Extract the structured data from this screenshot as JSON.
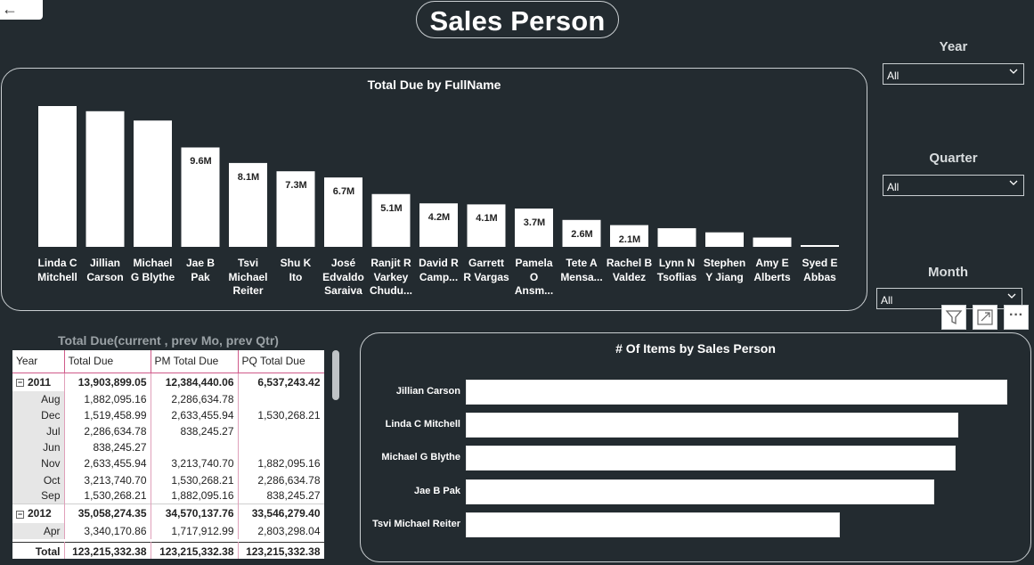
{
  "nav": {
    "back_icon": "←"
  },
  "page": {
    "title": "Sales Person"
  },
  "bar_chart": {
    "title": "Total Due by FullName",
    "bars": [
      {
        "label": "Linda C Mitchell",
        "lines": [
          "Linda C",
          "Mitchell"
        ],
        "value": 13.6,
        "value_label": ""
      },
      {
        "label": "Jillian Carson",
        "lines": [
          "Jillian",
          "Carson"
        ],
        "value": 13.1,
        "value_label": ""
      },
      {
        "label": "Michael G Blythe",
        "lines": [
          "Michael",
          "G Blythe"
        ],
        "value": 12.2,
        "value_label": ""
      },
      {
        "label": "Jae B Pak",
        "lines": [
          "Jae B",
          "Pak"
        ],
        "value": 9.6,
        "value_label": "9.6M"
      },
      {
        "label": "Tsvi Michael Reiter",
        "lines": [
          "Tsvi",
          "Michael",
          "Reiter"
        ],
        "value": 8.1,
        "value_label": "8.1M"
      },
      {
        "label": "Shu K Ito",
        "lines": [
          "Shu K",
          "Ito"
        ],
        "value": 7.3,
        "value_label": "7.3M"
      },
      {
        "label": "José Edvaldo Saraiva",
        "lines": [
          "José",
          "Edvaldo",
          "Saraiva"
        ],
        "value": 6.7,
        "value_label": "6.7M"
      },
      {
        "label": "Ranjit R Varkey Chudu...",
        "lines": [
          "Ranjit R",
          "Varkey",
          "Chudu..."
        ],
        "value": 5.1,
        "value_label": "5.1M"
      },
      {
        "label": "David R Camp...",
        "lines": [
          "David R",
          "Camp..."
        ],
        "value": 4.2,
        "value_label": "4.2M"
      },
      {
        "label": "Garrett R Vargas",
        "lines": [
          "Garrett",
          "R Vargas"
        ],
        "value": 4.1,
        "value_label": "4.1M"
      },
      {
        "label": "Pamela O Ansm...",
        "lines": [
          "Pamela",
          "O",
          "Ansm..."
        ],
        "value": 3.7,
        "value_label": "3.7M"
      },
      {
        "label": "Tete A Mensa...",
        "lines": [
          "Tete A",
          "Mensa..."
        ],
        "value": 2.6,
        "value_label": "2.6M"
      },
      {
        "label": "Rachel B Valdez",
        "lines": [
          "Rachel B",
          "Valdez"
        ],
        "value": 2.1,
        "value_label": "2.1M"
      },
      {
        "label": "Lynn N Tsoflias",
        "lines": [
          "Lynn N",
          "Tsoflias"
        ],
        "value": 1.8,
        "value_label": ""
      },
      {
        "label": "Stephen Y Jiang",
        "lines": [
          "Stephen",
          "Y Jiang"
        ],
        "value": 1.4,
        "value_label": ""
      },
      {
        "label": "Amy E Alberts",
        "lines": [
          "Amy E",
          "Alberts"
        ],
        "value": 0.9,
        "value_label": ""
      },
      {
        "label": "Syed E Abbas",
        "lines": [
          "Syed E",
          "Abbas"
        ],
        "value": 0.17,
        "value_label": ""
      }
    ]
  },
  "chart_data": [
    {
      "type": "bar",
      "title": "Total Due by FullName",
      "categories": [
        "Linda C Mitchell",
        "Jillian Carson",
        "Michael G Blythe",
        "Jae B Pak",
        "Tsvi Michael Reiter",
        "Shu K Ito",
        "José Edvaldo Saraiva",
        "Ranjit R Varkey Chudu...",
        "David R Camp...",
        "Garrett R Vargas",
        "Pamela O Ansm...",
        "Tete A Mensa...",
        "Rachel B Valdez",
        "Lynn N Tsoflias",
        "Stephen Y Jiang",
        "Amy E Alberts",
        "Syed E Abbas"
      ],
      "values": [
        13.6,
        13.1,
        12.2,
        9.6,
        8.1,
        7.3,
        6.7,
        5.1,
        4.2,
        4.1,
        3.7,
        2.6,
        2.1,
        1.8,
        1.4,
        0.9,
        0.17
      ],
      "unit": "M"
    },
    {
      "type": "bar",
      "orientation": "horizontal",
      "title": "# Of Items by Sales Person",
      "categories": [
        "Jillian Carson",
        "Linda C Mitchell",
        "Michael G Blythe",
        "Jae B Pak",
        "Tsvi Michael Reiter"
      ],
      "values": [
        100,
        91,
        90.5,
        86.5,
        69
      ]
    }
  ],
  "slicers": [
    {
      "title": "Year",
      "value": "All"
    },
    {
      "title": "Quarter",
      "value": "All"
    },
    {
      "title": "Month",
      "value": "All"
    }
  ],
  "visual_header": {
    "icons": [
      "filter-icon",
      "focus-mode-icon",
      "more-options-icon"
    ],
    "more_label": "···"
  },
  "matrix": {
    "title": "Total Due(current , prev Mo, prev Qtr)",
    "columns": [
      "Year",
      "Total Due",
      "PM Total Due",
      "PQ Total Due"
    ],
    "rows": [
      {
        "kind": "year",
        "expander": "⊟",
        "label": "2011",
        "total_due": "13,903,899.05",
        "pm": "12,384,440.06",
        "pq": "6,537,243.42"
      },
      {
        "kind": "month",
        "label": "Aug",
        "total_due": "1,882,095.16",
        "pm": "2,286,634.78",
        "pq": ""
      },
      {
        "kind": "month",
        "label": "Dec",
        "total_due": "1,519,458.99",
        "pm": "2,633,455.94",
        "pq": "1,530,268.21"
      },
      {
        "kind": "month",
        "label": "Jul",
        "total_due": "2,286,634.78",
        "pm": "838,245.27",
        "pq": ""
      },
      {
        "kind": "month",
        "label": "Jun",
        "total_due": "838,245.27",
        "pm": "",
        "pq": ""
      },
      {
        "kind": "month",
        "label": "Nov",
        "total_due": "2,633,455.94",
        "pm": "3,213,740.70",
        "pq": "1,882,095.16"
      },
      {
        "kind": "month",
        "label": "Oct",
        "total_due": "3,213,740.70",
        "pm": "1,530,268.21",
        "pq": "2,286,634.78"
      },
      {
        "kind": "month",
        "label": "Sep",
        "total_due": "1,530,268.21",
        "pm": "1,882,095.16",
        "pq": "838,245.27"
      },
      {
        "kind": "year",
        "expander": "⊟",
        "label": "2012",
        "total_due": "35,058,274.35",
        "pm": "34,570,137.76",
        "pq": "33,546,279.40"
      },
      {
        "kind": "month",
        "label": "Apr",
        "total_due": "3,340,170.86",
        "pm": "1,717,912.99",
        "pq": "2,803,298.04"
      }
    ],
    "total": {
      "label": "Total",
      "total_due": "123,215,332.38",
      "pm": "123,215,332.38",
      "pq": "123,215,332.38"
    }
  },
  "hbar_chart": {
    "title": "# Of Items by Sales Person",
    "bars": [
      {
        "label": "Jillian Carson",
        "value": 100
      },
      {
        "label": "Linda C Mitchell",
        "value": 91
      },
      {
        "label": "Michael G Blythe",
        "value": 90.5
      },
      {
        "label": "Jae B Pak",
        "value": 86.5
      },
      {
        "label": "Tsvi Michael Reiter",
        "value": 69
      }
    ]
  },
  "colors": {
    "background": "#232b30",
    "bar": "#ffffff",
    "border": "#c9ced1",
    "matrix_accent": "#d05a8a"
  }
}
